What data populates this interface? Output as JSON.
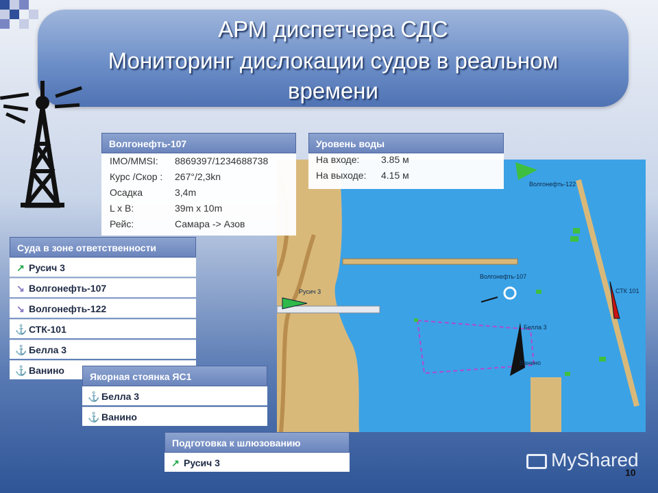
{
  "title": {
    "line1": "АРМ диспетчера СДС",
    "line2": "Мониторинг дислокации судов в реальном",
    "line3": "времени"
  },
  "vessel_card": {
    "header": "Волгонефть-107",
    "rows": [
      {
        "label": "IMO/MMSI:",
        "value": "8869397/1234688738"
      },
      {
        "label": "Курс /Скор :",
        "value": "267°/2,3kn"
      },
      {
        "label": "Осадка",
        "value": "3,4m"
      },
      {
        "label": "L x B:",
        "value": "39m x 10m"
      },
      {
        "label": "Рейс:",
        "value": "Самара -> Азов"
      }
    ]
  },
  "water_level": {
    "header": "Уровень воды",
    "rows": [
      {
        "label": "На входе:",
        "value": "3.85 м"
      },
      {
        "label": "На выходе:",
        "value": "4.15 м"
      }
    ]
  },
  "zone_panel": {
    "header": "Суда в зоне ответственности",
    "items": [
      {
        "label": "Русич 3",
        "icon": "green-arrow-icon"
      },
      {
        "label": "Волгонефть-107",
        "icon": "purple-arrow-icon"
      },
      {
        "label": "Волгонефть-122",
        "icon": "purple-arrow-icon"
      },
      {
        "label": "СТК-101",
        "icon": "anchor-icon"
      },
      {
        "label": "Белла 3",
        "icon": "anchor-icon"
      },
      {
        "label": "Ванино",
        "icon": "anchor-icon"
      }
    ]
  },
  "anchorage_panel": {
    "header": "Якорная стоянка ЯС1",
    "items": [
      {
        "label": "Белла 3",
        "icon": "anchor-icon"
      },
      {
        "label": "Ванино",
        "icon": "anchor-icon"
      }
    ]
  },
  "lock_panel": {
    "header": "Подготовка к шлюзованию",
    "items": [
      {
        "label": "Русич 3",
        "icon": "green-arrow-icon"
      }
    ]
  },
  "map": {
    "labels": {
      "volgoneft122": "Волгонефть-122",
      "volgoneft107": "Волгонефть-107",
      "rusich3": "Русич 3",
      "bella3": "Белла 3",
      "vanino": "Ванино",
      "stk101": "СТК 101"
    }
  },
  "icons": {
    "arrow_green": "↗",
    "arrow_purple": "↘",
    "anchor": "⚓"
  },
  "colors": {
    "water": "#3ba2e6",
    "land": "#d9b97a",
    "panel_header": "#6b85bd",
    "accent_green": "#22a84b",
    "anchor_red": "#c0392b"
  },
  "watermark": {
    "brand": "MyShared"
  },
  "page_number": "10"
}
